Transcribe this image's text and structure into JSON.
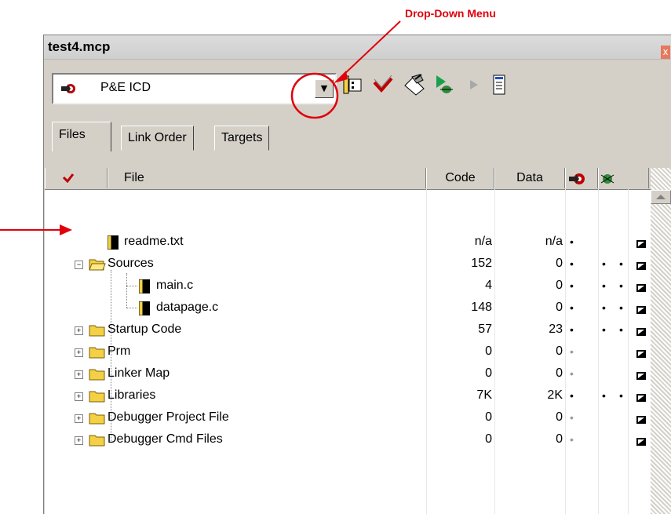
{
  "annotation": {
    "label": "Drop-Down Menu"
  },
  "window": {
    "title": "test4.mcp",
    "close_label": "x"
  },
  "toolbar": {
    "target_combo": {
      "value": "P&E ICD",
      "arrow": "▼"
    }
  },
  "tabs": [
    {
      "label": "Files",
      "active": true
    },
    {
      "label": "Link Order",
      "active": false
    },
    {
      "label": "Targets",
      "active": false
    }
  ],
  "columns": {
    "file": "File",
    "code": "Code",
    "data": "Data"
  },
  "rows": [
    {
      "name": "readme.txt",
      "code": "n/a",
      "data": "n/a"
    },
    {
      "name": "Sources",
      "code": "152",
      "data": "0"
    },
    {
      "name": "main.c",
      "code": "4",
      "data": "0"
    },
    {
      "name": "datapage.c",
      "code": "148",
      "data": "0"
    },
    {
      "name": "Startup Code",
      "code": "57",
      "data": "23"
    },
    {
      "name": "Prm",
      "code": "0",
      "data": "0"
    },
    {
      "name": "Linker Map",
      "code": "0",
      "data": "0"
    },
    {
      "name": "Libraries",
      "code": "7K",
      "data": "2K"
    },
    {
      "name": "Debugger Project File",
      "code": "0",
      "data": "0"
    },
    {
      "name": "Debugger Cmd Files",
      "code": "0",
      "data": "0"
    }
  ],
  "glyphs": {
    "expand_plus": "+",
    "collapse_minus": "−",
    "bullet": "•"
  },
  "colors": {
    "annotation_red": "#e0000b",
    "folder_yellow": "#f3d046",
    "chrome": "#d4d0c8"
  }
}
